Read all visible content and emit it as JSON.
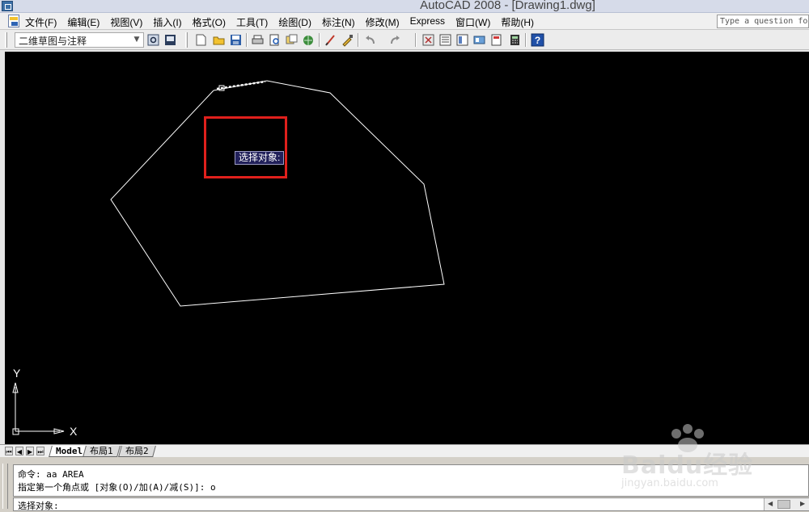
{
  "window": {
    "title": "AutoCAD 2008 - [Drawing1.dwg]"
  },
  "menu": {
    "items": [
      {
        "label": "文件(F)",
        "name": "menu-file"
      },
      {
        "label": "编辑(E)",
        "name": "menu-edit"
      },
      {
        "label": "视图(V)",
        "name": "menu-view"
      },
      {
        "label": "插入(I)",
        "name": "menu-insert"
      },
      {
        "label": "格式(O)",
        "name": "menu-format"
      },
      {
        "label": "工具(T)",
        "name": "menu-tools"
      },
      {
        "label": "绘图(D)",
        "name": "menu-draw"
      },
      {
        "label": "标注(N)",
        "name": "menu-dimension"
      },
      {
        "label": "修改(M)",
        "name": "menu-modify"
      },
      {
        "label": "Express",
        "name": "menu-express"
      },
      {
        "label": "窗口(W)",
        "name": "menu-window"
      },
      {
        "label": "帮助(H)",
        "name": "menu-help"
      }
    ],
    "help_search_placeholder": "Type a question for help"
  },
  "toolbar": {
    "workspace_value": "二维草图与注释",
    "buttons": [
      "workspace-settings-icon",
      "workspace-save-icon",
      "new-icon",
      "open-icon",
      "save-icon",
      "plot-icon",
      "plot-preview-icon",
      "publish-icon",
      "3d-dwf-icon",
      "cut-icon",
      "match-properties-icon",
      "undo-icon",
      "redo-icon",
      "pan-icon",
      "properties-icon",
      "design-center-icon",
      "tool-palettes-icon",
      "sheet-set-icon",
      "markup-icon",
      "quickcalc-icon",
      "help-icon"
    ]
  },
  "drawing": {
    "tooltip": "选择对象:",
    "ucs_y": "Y",
    "ucs_x": "X"
  },
  "tabs": {
    "items": [
      "Model",
      "布局1",
      "布局2"
    ],
    "active": "Model"
  },
  "command": {
    "history": [
      "命令: aa AREA",
      "指定第一个角点或 [对象(O)/加(A)/减(S)]: o"
    ],
    "prompt": "选择对象:"
  },
  "watermark": {
    "brand": "Baidu经验",
    "url": "jingyan.baidu.com"
  },
  "colors": {
    "canvas_bg": "#000000",
    "geometry": "#ffffff",
    "highlight": "#e0201c",
    "tooltip_bg": "#21205a"
  }
}
